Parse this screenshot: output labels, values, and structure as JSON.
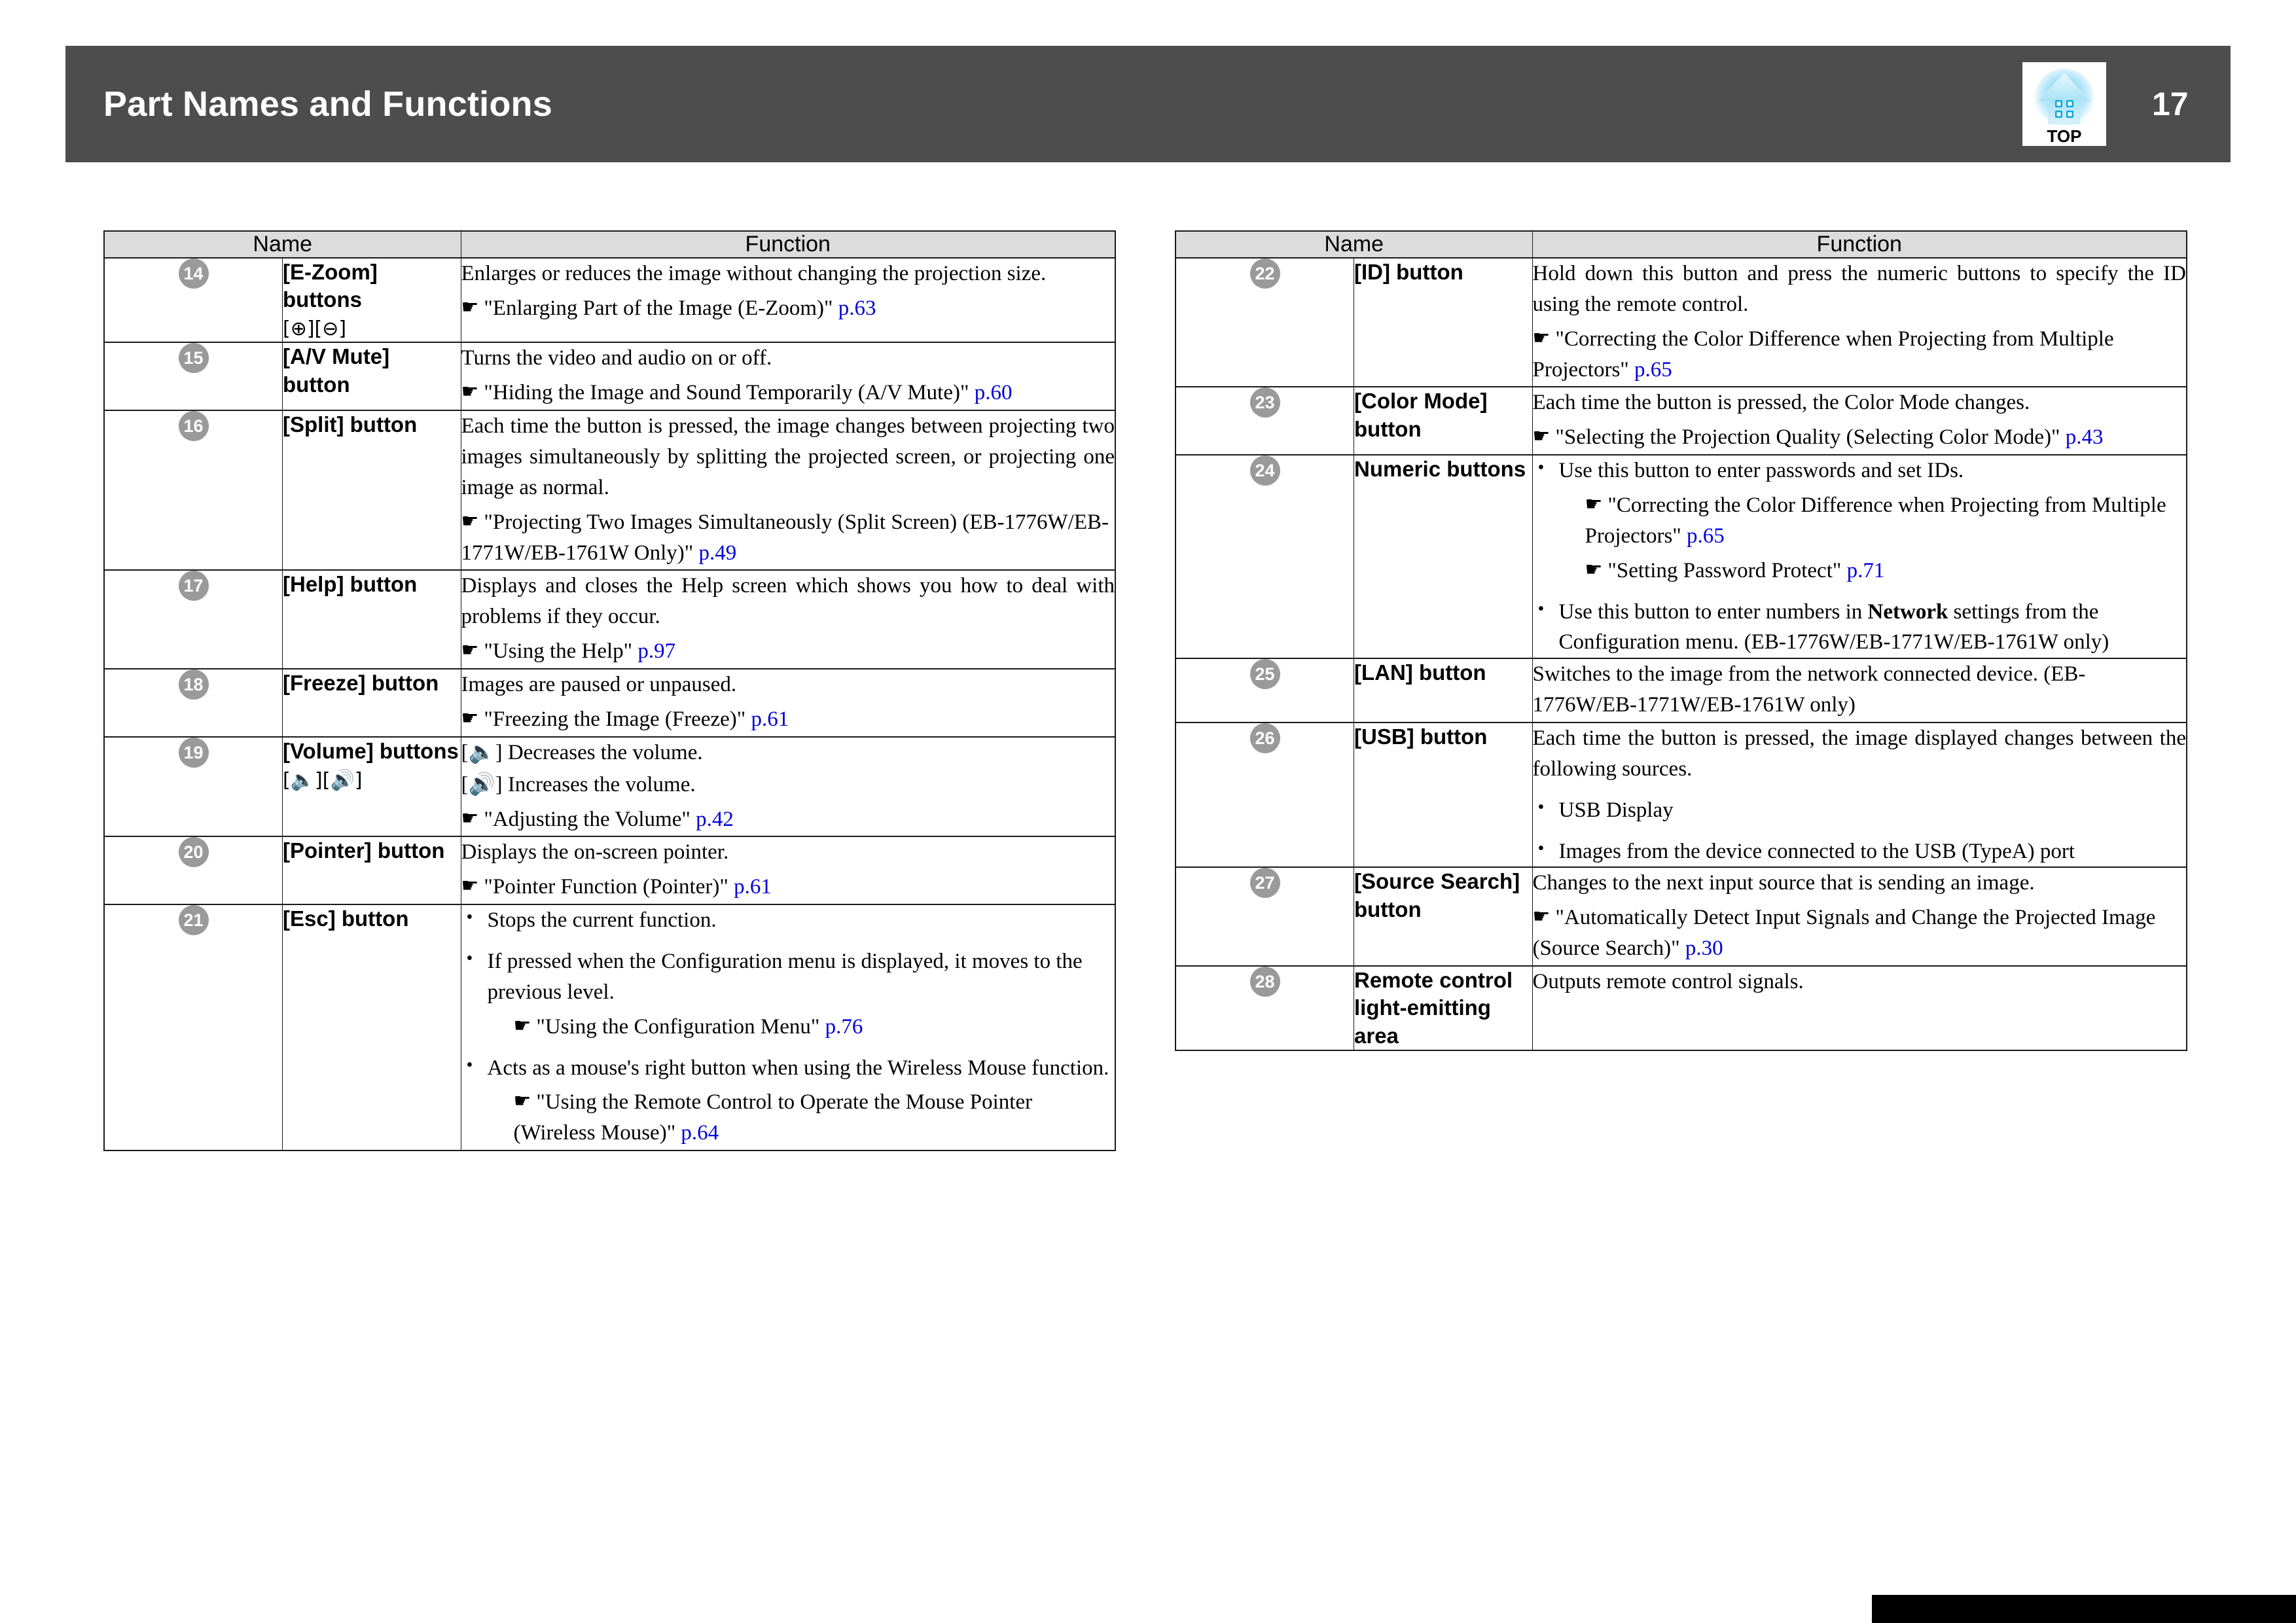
{
  "header": {
    "title": "Part Names and Functions",
    "page_number": "17",
    "top_icon_label": "TOP",
    "bar_color": "#4d4d4d"
  },
  "link_color": "#0000dd",
  "table_headers": {
    "name": "Name",
    "function": "Function"
  },
  "icons": {
    "hand": "☛",
    "bullet": "•",
    "zoom_in": "[⊕]",
    "zoom_out": "[⊖]",
    "volume_down": "[🔈]",
    "volume_up": "[🔊]"
  },
  "left_table": {
    "rows": [
      {
        "num": "14",
        "name": "[E-Zoom] buttons",
        "name_sub": "[⊕][⊖]",
        "lines": [
          "Enlarges or reduces the image without changing the projection size."
        ],
        "refs": [
          {
            "text": "\"Enlarging Part of the Image (E-Zoom)\"",
            "page": "p.63"
          }
        ]
      },
      {
        "num": "15",
        "name": "[A/V Mute] button",
        "lines": [
          "Turns the video and audio on or off."
        ],
        "refs": [
          {
            "text": "\"Hiding the Image and Sound Temporarily (A/V Mute)\"",
            "page": "p.60"
          }
        ]
      },
      {
        "num": "16",
        "name": "[Split] button",
        "lines": [
          "Each time the button is pressed, the image changes between projecting two images simultaneously by splitting the projected screen, or projecting one image as normal."
        ],
        "refs": [
          {
            "text": "\"Projecting Two Images Simultaneously (Split Screen) (EB-1776W/EB-1771W/EB-1761W Only)\"",
            "page": "p.49"
          }
        ]
      },
      {
        "num": "17",
        "name": "[Help] button",
        "lines": [
          "Displays and closes the Help screen which shows you how to deal with problems if they occur."
        ],
        "refs": [
          {
            "text": "\"Using the Help\"",
            "page": "p.97"
          }
        ]
      },
      {
        "num": "18",
        "name": "[Freeze] button",
        "lines": [
          "Images are paused or unpaused."
        ],
        "refs": [
          {
            "text": "\"Freezing the Image (Freeze)\"",
            "page": "p.61"
          }
        ]
      },
      {
        "num": "19",
        "name": "[Volume] buttons",
        "name_sub": "[🔈][🔊]",
        "lines": [
          "[🔈] Decreases the volume.",
          "[🔊] Increases the volume."
        ],
        "refs": [
          {
            "text": "\"Adjusting the Volume\"",
            "page": "p.42"
          }
        ]
      },
      {
        "num": "20",
        "name": "[Pointer] button",
        "lines": [
          "Displays the on-screen pointer."
        ],
        "refs": [
          {
            "text": "\"Pointer Function (Pointer)\"",
            "page": "p.61"
          }
        ]
      },
      {
        "num": "21",
        "name": "[Esc] button",
        "bullets": [
          {
            "text": "Stops the current function."
          },
          {
            "text": "If pressed when the Configuration menu is displayed, it moves to the previous level.",
            "refs": [
              {
                "text": "\"Using the Configuration Menu\"",
                "page": "p.76"
              }
            ]
          },
          {
            "text": "Acts as a mouse's right button when using the Wireless Mouse function.",
            "refs": [
              {
                "text": "\"Using the Remote Control to Operate the Mouse Pointer (Wireless Mouse)\"",
                "page": "p.64"
              }
            ]
          }
        ]
      }
    ]
  },
  "right_table": {
    "rows": [
      {
        "num": "22",
        "name": "[ID] button",
        "lines": [
          "Hold down this button and press the numeric buttons to specify the ID using the remote control."
        ],
        "refs": [
          {
            "text": "\"Correcting the Color Difference when Projecting from Multiple Projectors\"",
            "page": "p.65"
          }
        ]
      },
      {
        "num": "23",
        "name": "[Color Mode] button",
        "lines": [
          "Each time the button is pressed, the Color Mode changes."
        ],
        "refs": [
          {
            "text": "\"Selecting the Projection Quality (Selecting Color Mode)\"",
            "page": "p.43"
          }
        ]
      },
      {
        "num": "24",
        "name": "Numeric buttons",
        "bullets": [
          {
            "text": "Use this button to enter passwords and set IDs.",
            "refs": [
              {
                "text": "\"Correcting the Color Difference when Projecting from Multiple Projectors\"",
                "page": "p.65"
              },
              {
                "text": "\"Setting Password Protect\"",
                "page": "p.71"
              }
            ]
          },
          {
            "text": "Use this button to enter numbers in Network settings from the Configuration menu. (EB-1776W/EB-1771W/EB-1761W only)",
            "bold_word": "Network"
          }
        ]
      },
      {
        "num": "25",
        "name": "[LAN] button",
        "lines": [
          "Switches to the image from the network connected device. (EB-1776W/EB-1771W/EB-1761W only)"
        ]
      },
      {
        "num": "26",
        "name": "[USB] button",
        "lines": [
          "Each time the button is pressed, the image displayed changes between the following sources."
        ],
        "bullets": [
          {
            "text": "USB Display"
          },
          {
            "text": "Images from the device connected to the USB (TypeA) port"
          }
        ]
      },
      {
        "num": "27",
        "name": "[Source Search] button",
        "lines": [
          "Changes to the next input source that is sending an image."
        ],
        "refs": [
          {
            "text": "\"Automatically Detect Input Signals and Change the Projected Image (Source Search)\"",
            "page": "p.30"
          }
        ]
      },
      {
        "num": "28",
        "name": "Remote control light-emitting area",
        "lines": [
          "Outputs remote control signals."
        ]
      }
    ]
  }
}
